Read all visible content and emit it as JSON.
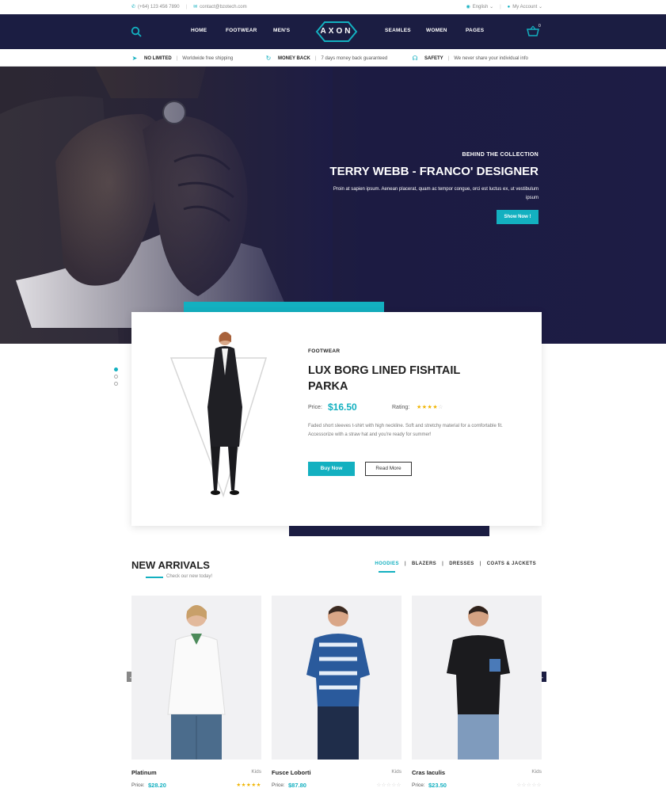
{
  "topbar": {
    "phone": "(+64) 123 456 7890",
    "email": "contact@bzotech.com",
    "language": "English",
    "account": "My Account"
  },
  "nav": {
    "logo": "AXON",
    "left_items": [
      "HOME",
      "FOOTWEAR",
      "MEN'S"
    ],
    "right_items": [
      "SEAMLES",
      "WOMEN",
      "PAGES"
    ],
    "cart_count": "0"
  },
  "features": [
    {
      "icon": "send-icon",
      "title": "NO LIMITED",
      "text": "Worldwide free shipping"
    },
    {
      "icon": "refresh-icon",
      "title": "MONEY BACK",
      "text": "7 days money back guaranteed"
    },
    {
      "icon": "headset-icon",
      "title": "SAFETY",
      "text": "We never share your individual info"
    }
  ],
  "hero": {
    "kicker": "BEHIND THE COLLECTION",
    "title": "TERRY WEBB - FRANCO' DESIGNER",
    "subtitle": "Proin at sapien ipsum. Aenean placerat, quam ac tempor congue, orci est luctus ex, ut vestibulum ipsum",
    "button": "Show Now !"
  },
  "featured": {
    "category": "FOOTWEAR",
    "title": "LUX BORG LINED FISHTAIL PARKA",
    "price_label": "Price:",
    "price": "$16.50",
    "rating_label": "Rating:",
    "rating": 4,
    "description": "Faded short sleeves t-shirt with high neckline. Soft and stretchy material for a comfortable fit. Accessorize with a straw hat and you're ready for summer!",
    "buy_label": "Buy Now",
    "read_label": "Read More"
  },
  "arrivals": {
    "title": "NEW ARRIVALS",
    "subtitle": "Check our new today!",
    "tabs": [
      "HOODIES",
      "BLAZERS",
      "DRESSES",
      "COATS & JACKETS"
    ],
    "active_tab": "HOODIES",
    "products": [
      {
        "name": "Platinum",
        "category": "Kids",
        "price_label": "Price:",
        "price": "$28.20",
        "rating": 5
      },
      {
        "name": "Fusce Loborti",
        "category": "Kids",
        "price_label": "Price:",
        "price": "$87.80",
        "rating": 0
      },
      {
        "name": "Cras Iaculis",
        "category": "Kids",
        "price_label": "Price:",
        "price": "$23.50",
        "rating": 0
      }
    ]
  },
  "colors": {
    "accent": "#13b0c0",
    "navy": "#1b1d42"
  }
}
